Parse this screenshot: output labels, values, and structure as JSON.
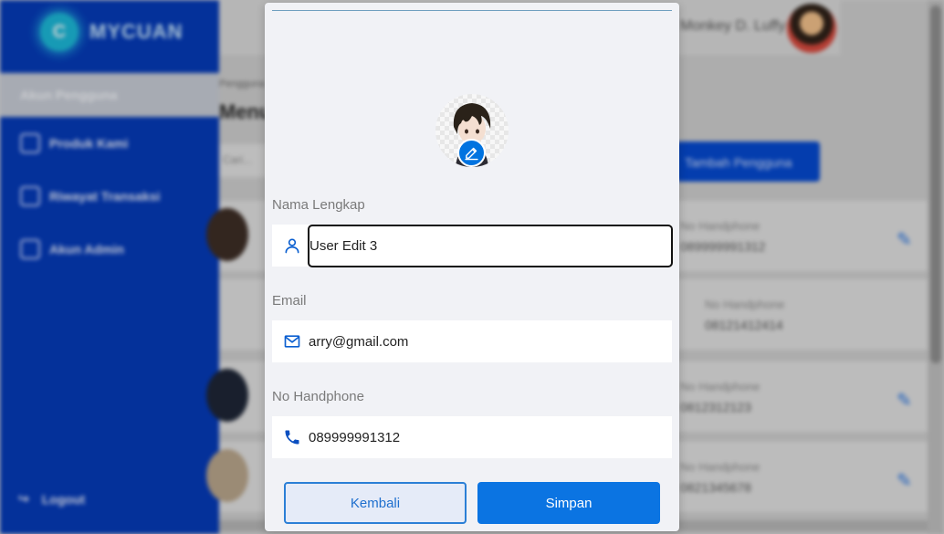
{
  "background": {
    "brand": {
      "logo_letter": "C",
      "name": "MYCUAN"
    },
    "sidebar": {
      "items": [
        {
          "label": "Akun Pengguna",
          "icon": "users-icon",
          "active": true
        },
        {
          "label": "Produk Kami",
          "icon": "box-icon"
        },
        {
          "label": "Riwayat Transaksi",
          "icon": "history-icon"
        },
        {
          "label": "Akun Admin",
          "icon": "admin-icon"
        }
      ],
      "logout_label": "Logout"
    },
    "header": {
      "user_name": "Monkey D. Luffy"
    },
    "breadcrumb": "Pengguna",
    "page_title": "Menu Pengguna",
    "search_placeholder": "Cari...",
    "add_button_label": "Tambah Pengguna",
    "rows": [
      {
        "label": "No Handphone",
        "value": "089999991312"
      },
      {
        "label": "No Handphone",
        "value": "08121412414"
      },
      {
        "label": "No Handphone",
        "value": "0812312123"
      },
      {
        "label": "No Handphone",
        "value": "0821345678"
      }
    ]
  },
  "modal": {
    "avatar_edit_icon": "pencil-icon",
    "fields": {
      "name": {
        "label": "Nama Lengkap",
        "value": "User Edit 3",
        "icon": "user-icon"
      },
      "email": {
        "label": "Email",
        "value": "arry@gmail.com",
        "icon": "mail-icon"
      },
      "phone": {
        "label": "No Handphone",
        "value": "089999991312",
        "icon": "phone-icon"
      }
    },
    "buttons": {
      "back": "Kembali",
      "save": "Simpan"
    }
  },
  "colors": {
    "primary": "#0b74e2",
    "sidebar": "#0037b8",
    "modal_bg": "#f1f2f6"
  }
}
